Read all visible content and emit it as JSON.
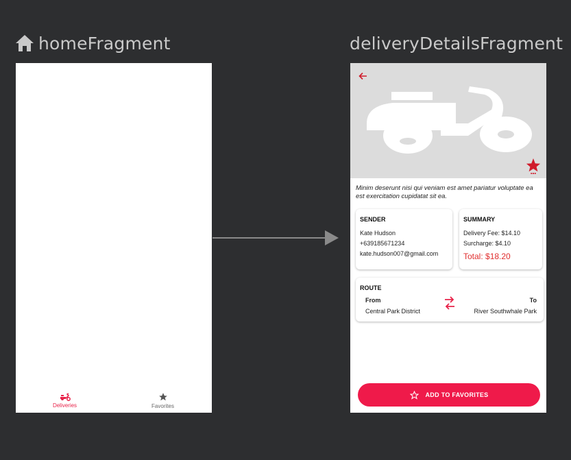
{
  "colors": {
    "canvas": "#2d2e30",
    "accent": "#ef1a4a",
    "total": "#e02d2d",
    "hero_bg": "#dcdcdc"
  },
  "home": {
    "title": "homeFragment",
    "title_icon": "home-icon",
    "nav": [
      {
        "label": "Deliveries",
        "icon": "scooter-icon",
        "active": true
      },
      {
        "label": "Favorites",
        "icon": "star-icon",
        "active": false
      }
    ]
  },
  "details": {
    "title": "deliveryDetailsFragment",
    "description": "Minim deserunt nisi qui veniam est amet pariatur voluptate ea est exercitation cupidatat sit ea.",
    "sender": {
      "heading": "SENDER",
      "name": "Kate Hudson",
      "phone": "+639185671234",
      "email": "kate.hudson007@gmail.com"
    },
    "summary": {
      "heading": "SUMMARY",
      "delivery_fee": "Delivery Fee: $14.10",
      "surcharge": "Surcharge: $4.10",
      "total": "Total: $18.20"
    },
    "route": {
      "heading": "ROUTE",
      "from_label": "From",
      "from_value": "Central Park District",
      "to_label": "To",
      "to_value": "River Southwhale Park"
    },
    "add_button": "ADD TO FAVORITES"
  }
}
